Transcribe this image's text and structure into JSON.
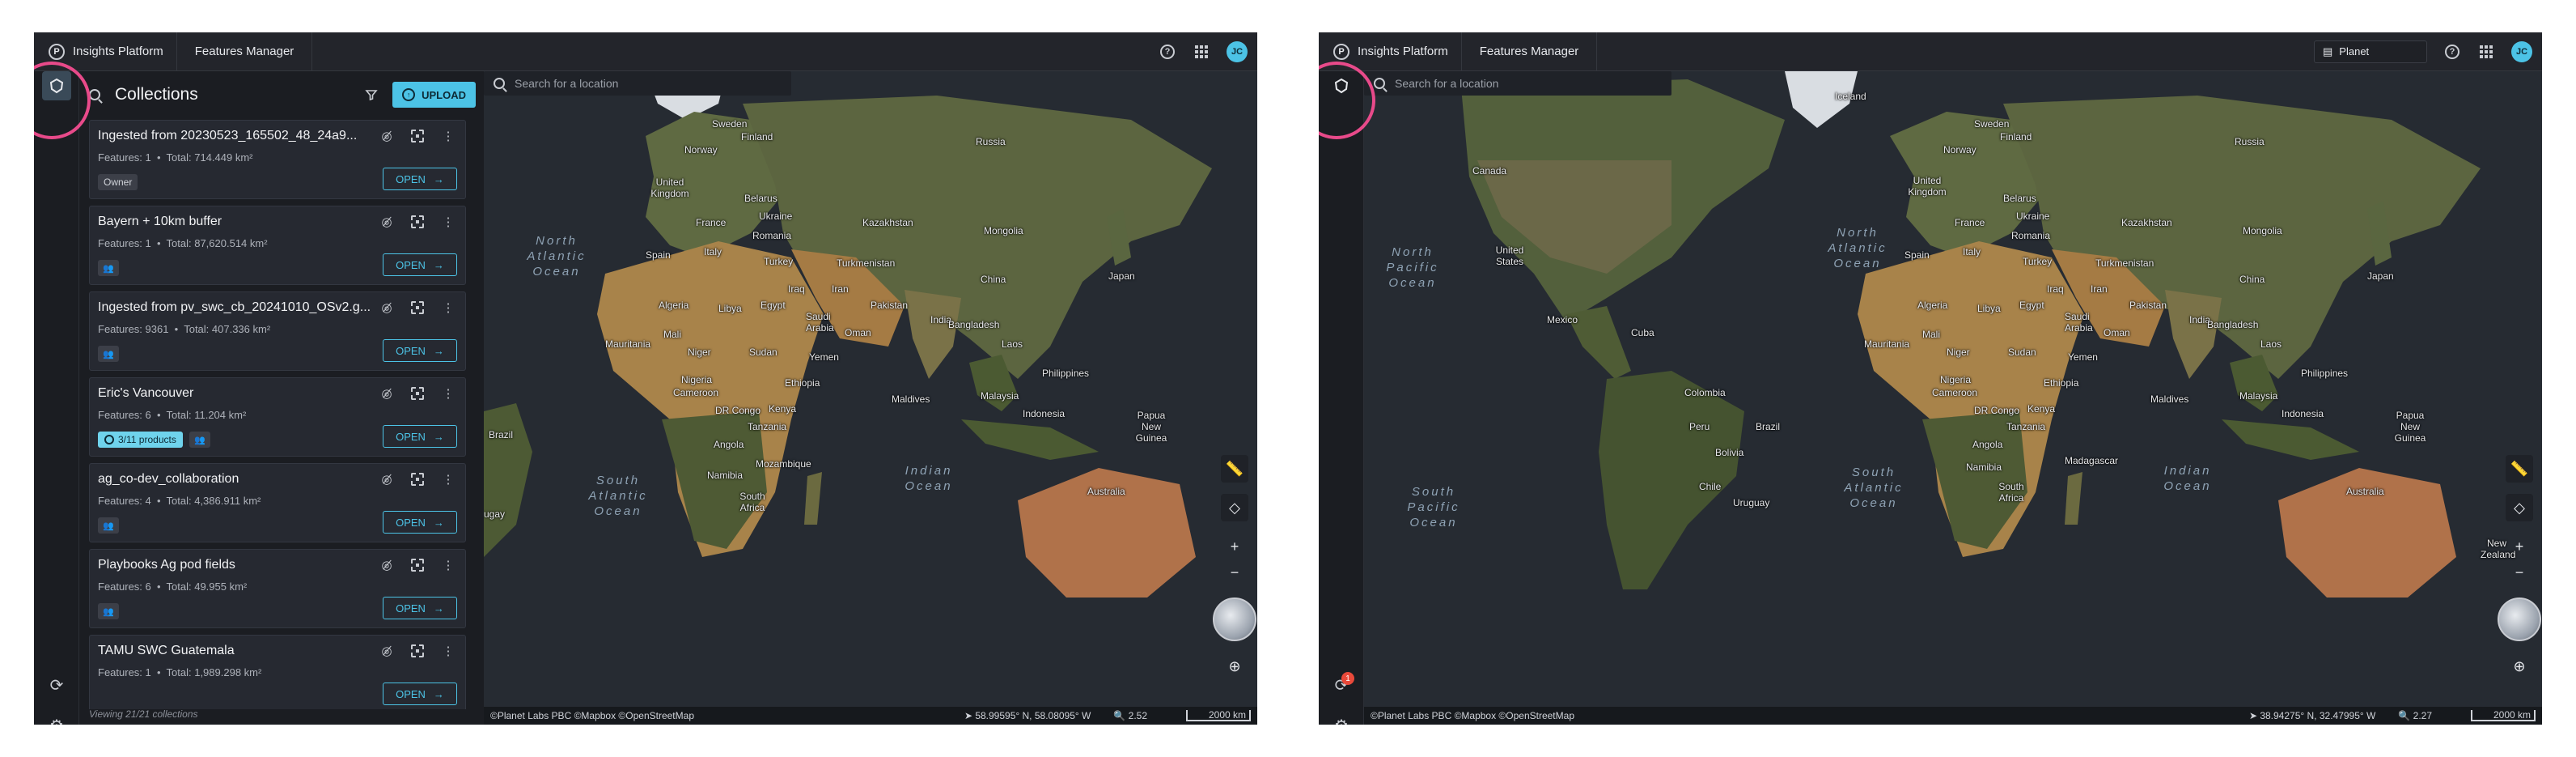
{
  "left": {
    "topbar": {
      "brand_logo": "P",
      "brand": "Insights Platform",
      "crumb": "Features Manager",
      "help": "?",
      "avatar": "JC"
    },
    "panel": {
      "title": "Collections",
      "upload_label": "UPLOAD",
      "cards": [
        {
          "name": "Ingested from 20230523_165502_48_24a9...",
          "features": "Features: 1",
          "total": "Total: 714.449 km²",
          "tag": "Owner",
          "open_label": "OPEN"
        },
        {
          "name": "Bayern + 10km buffer",
          "features": "Features: 1",
          "total": "Total: 87,620.514 km²",
          "open_label": "OPEN"
        },
        {
          "name": "Ingested from pv_swc_cb_20241010_OSv2.g...",
          "features": "Features: 9361",
          "total": "Total: 407.336 km²",
          "open_label": "OPEN"
        },
        {
          "name": "Eric's Vancouver",
          "features": "Features: 6",
          "total": "Total: 11.204 km²",
          "products": "3/11 products",
          "open_label": "OPEN"
        },
        {
          "name": "ag_co-dev_collaboration",
          "features": "Features: 4",
          "total": "Total: 4,386.911 km²",
          "open_label": "OPEN"
        },
        {
          "name": "Playbooks Ag pod fields",
          "features": "Features: 6",
          "total": "Total: 49.955 km²",
          "open_label": "OPEN"
        },
        {
          "name": "TAMU SWC Guatemala",
          "features": "Features: 1",
          "total": "Total: 1,989.298 km²",
          "open_label": "OPEN"
        }
      ],
      "footer": "Viewing 21/21 collections"
    },
    "search_placeholder": "Search for a location",
    "map_labels": {
      "sweden": "Sweden",
      "finland": "Finland",
      "norway": "Norway",
      "russia": "Russia",
      "uk": "United Kingdom",
      "belarus": "Belarus",
      "ukraine": "Ukraine",
      "france": "France",
      "kazakhstan": "Kazakhstan",
      "mongolia": "Mongolia",
      "spain": "Spain",
      "italy": "Italy",
      "romania": "Romania",
      "turkey": "Turkey",
      "turkmenistan": "Turkmenistan",
      "china": "China",
      "japan": "Japan",
      "iraq": "Iraq",
      "iran": "Iran",
      "pakistan": "Pakistan",
      "algeria": "Algeria",
      "libya": "Libya",
      "egypt": "Egypt",
      "saudi": "Saudi Arabia",
      "oman": "Oman",
      "india": "India",
      "bangladesh": "Bangladesh",
      "laos": "Laos",
      "mauritania": "Mauritania",
      "mali": "Mali",
      "niger": "Niger",
      "sudan": "Sudan",
      "yemen": "Yemen",
      "nigeria": "Nigeria",
      "ethiopia": "Ethiopia",
      "philippines": "Philippines",
      "cameroon": "Cameroon",
      "maldives": "Maldives",
      "malaysia": "Malaysia",
      "kenya": "Kenya",
      "drc": "DR Congo",
      "indonesia": "Indonesia",
      "tanzania": "Tanzania",
      "png": "Papua New Guinea",
      "angola": "Angola",
      "brazil": "Brazil",
      "namibia": "Namibia",
      "mozambique": "Mozambique",
      "south_africa": "South Africa",
      "australia": "Australia",
      "uruguay": "ugay"
    },
    "oceans": {
      "north_atlantic": "North Atlantic Ocean",
      "south_atlantic": "South Atlantic Ocean",
      "indian": "Indian Ocean"
    },
    "status": {
      "attribution": "©Planet Labs PBC ©Mapbox ©OpenStreetMap",
      "coords": "58.99595° N, 58.08095° W",
      "zoom": "2.52",
      "scale": "2000 km"
    }
  },
  "right": {
    "topbar": {
      "brand_logo": "P",
      "brand": "Insights Platform",
      "crumb": "Features Manager",
      "basemap": "Planet",
      "help": "?",
      "avatar": "JC"
    },
    "notification_count": "1",
    "search_placeholder": "Search for a location",
    "map_labels": {
      "iceland": "Iceland",
      "finland": "Finland",
      "sweden": "Sweden",
      "norway": "Norway",
      "russia": "Russia",
      "canada": "Canada",
      "uk": "United Kingdom",
      "belarus": "Belarus",
      "ukraine": "Ukraine",
      "france": "France",
      "kazakhstan": "Kazakhstan",
      "mongolia": "Mongolia",
      "usa": "United States",
      "spain": "Spain",
      "italy": "Italy",
      "romania": "Romania",
      "turkey": "Turkey",
      "turkmenistan": "Turkmenistan",
      "china": "China",
      "japan": "Japan",
      "iraq": "Iraq",
      "iran": "Iran",
      "pakistan": "Pakistan",
      "mexico": "Mexico",
      "cuba": "Cuba",
      "algeria": "Algeria",
      "libya": "Libya",
      "egypt": "Egypt",
      "saudi": "Saudi Arabia",
      "oman": "Oman",
      "india": "India",
      "bangladesh": "Bangladesh",
      "laos": "Laos",
      "mauritania": "Mauritania",
      "mali": "Mali",
      "niger": "Niger",
      "sudan": "Sudan",
      "yemen": "Yemen",
      "nigeria": "Nigeria",
      "ethiopia": "Ethiopia",
      "philippines": "Philippines",
      "colombia": "Colombia",
      "cameroon": "Cameroon",
      "maldives": "Maldives",
      "malaysia": "Malaysia",
      "kenya": "Kenya",
      "drc": "DR Congo",
      "indonesia": "Indonesia",
      "peru": "Peru",
      "brazil": "Brazil",
      "tanzania": "Tanzania",
      "png": "Papua New Guinea",
      "bolivia": "Bolivia",
      "angola": "Angola",
      "madagascar": "Madagascar",
      "namibia": "Namibia",
      "chile": "Chile",
      "uruguay": "Uruguay",
      "south_africa": "South Africa",
      "australia": "Australia",
      "new_zealand": "New Zealand"
    },
    "oceans": {
      "north_pacific": "North Pacific Ocean",
      "north_atlantic": "North Atlantic Ocean",
      "south_pacific": "South Pacific Ocean",
      "south_atlantic": "South Atlantic Ocean",
      "indian": "Indian Ocean"
    },
    "status": {
      "attribution": "©Planet Labs PBC ©Mapbox ©OpenStreetMap",
      "coords": "38.94275° N, 32.47995° W",
      "zoom": "2.27",
      "scale": "2000 km"
    }
  },
  "colors": {
    "accent": "#4cc3e6",
    "highlight": "#e84a8a",
    "panel_bg": "#1b1d22",
    "card_bg": "#262931",
    "ocean": "#262b32",
    "land": "#7a6a4a"
  }
}
